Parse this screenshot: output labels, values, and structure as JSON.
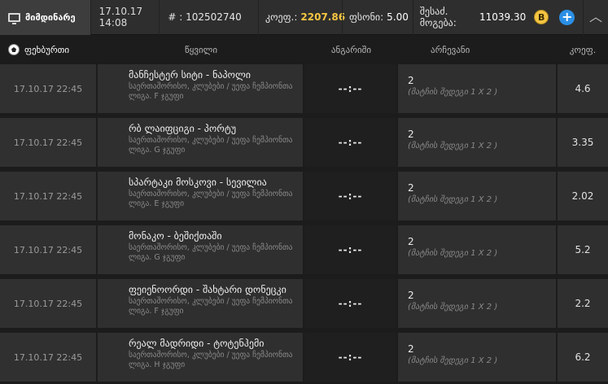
{
  "topbar": {
    "current_tab": "მიმდინარე",
    "date": "17.10.17 14:08",
    "ticket_label": "# : 102502740",
    "odds_label": "კოეფ.:",
    "odds_value": "2207.86",
    "stake_label": "ფსონი:",
    "stake_value": "5.00",
    "win_label": "შესაძ. მოგება:",
    "win_value": "11039.30",
    "bonus_badge": "B",
    "add_glyph": "+",
    "collapse_glyph": "︿"
  },
  "header": {
    "sport": "ფეხბურთი",
    "event": "წყვილი",
    "score": "ანგარიში",
    "choice": "არჩევანი",
    "odd": "კოეფ."
  },
  "rows": [
    {
      "date": "17.10.17 22:45",
      "teams": "მანჩესტერ სიტი - ნაპოლი",
      "league": "საერთაშორისო, კლუბები / უეფა ჩემპიონთა ლიგა. F ჯგუფი",
      "score": "--:--",
      "pick": "2",
      "sub": "(მატჩის შედეგი 1 X 2 )",
      "odd": "4.6"
    },
    {
      "date": "17.10.17 22:45",
      "teams": "რბ ლაიფციგი - პორტუ",
      "league": "საერთაშორისო, კლუბები / უეფა ჩემპიონთა ლიგა. G ჯგუფი",
      "score": "--:--",
      "pick": "2",
      "sub": "(მატჩის შედეგი 1 X 2 )",
      "odd": "3.35"
    },
    {
      "date": "17.10.17 22:45",
      "teams": "სპარტაკი მოსკოვი - სევილია",
      "league": "საერთაშორისო, კლუბები / უეფა ჩემპიონთა ლიგა. E ჯგუფი",
      "score": "--:--",
      "pick": "2",
      "sub": "(მატჩის შედეგი 1 X 2 )",
      "odd": "2.02"
    },
    {
      "date": "17.10.17 22:45",
      "teams": "მონაკო - ბეშიქთაში",
      "league": "საერთაშორისო, კლუბები / უეფა ჩემპიონთა ლიგა. G ჯგუფი",
      "score": "--:--",
      "pick": "2",
      "sub": "(მატჩის შედეგი 1 X 2 )",
      "odd": "5.2"
    },
    {
      "date": "17.10.17 22:45",
      "teams": "ფეიენოორდი - შახტარი დონეცკი",
      "league": "საერთაშორისო, კლუბები / უეფა ჩემპიონთა ლიგა. F ჯგუფი",
      "score": "--:--",
      "pick": "2",
      "sub": "(მატჩის შედეგი 1 X 2 )",
      "odd": "2.2"
    },
    {
      "date": "17.10.17 22:45",
      "teams": "რეალ მადრიდი - ტოტენჰემი",
      "league": "საერთაშორისო, კლუბები / უეფა ჩემპიონთა ლიგა. H ჯგუფი",
      "score": "--:--",
      "pick": "2",
      "sub": "(მატჩის შედეგი 1 X 2 )",
      "odd": "6.2"
    }
  ]
}
